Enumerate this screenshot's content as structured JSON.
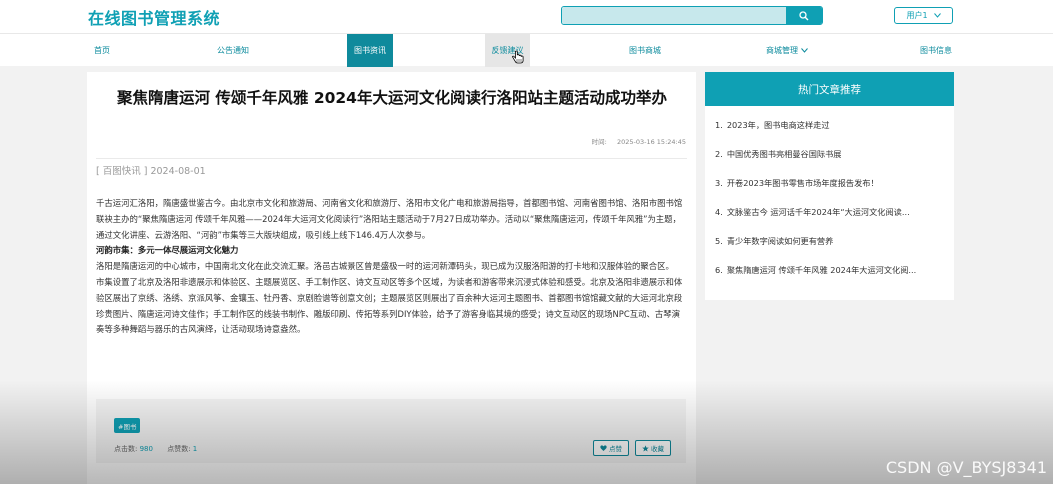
{
  "header": {
    "logo": "在线图书管理系统",
    "search_placeholder": "",
    "user_label": "用户1"
  },
  "nav": [
    {
      "label": "首页"
    },
    {
      "label": "公告通知"
    },
    {
      "label": "图书资讯"
    },
    {
      "label": "反馈建议"
    },
    {
      "label": "图书商城"
    },
    {
      "label": "商城管理"
    },
    {
      "label": "图书信息"
    }
  ],
  "article": {
    "title": "聚焦隋唐运河 传颂千年风雅 2024年大运河文化阅读行洛阳站主题活动成功举办",
    "time_label": "时间:",
    "time_value": "2025-03-16 15:24:45",
    "tag_line": "[ 百图快讯 ] 2024-08-01",
    "para1": "千古运河汇洛阳，隋唐盛世鉴古今。由北京市文化和旅游局、河南省文化和旅游厅、洛阳市文化广电和旅游局指导，首都图书馆、河南省图书馆、洛阳市图书馆联袂主办的“聚焦隋唐运河 传颂千年风雅——2024年大运河文化阅读行”洛阳站主题活动于7月27日成功举办。活动以“聚焦隋唐运河，传颂千年风雅”为主题，通过文化讲座、云游洛阳、“河韵”市集等三大版块组成，吸引线上线下146.4万人次参与。",
    "subtitle": "河韵市集：多元一体尽展运河文化魅力",
    "para2": "洛阳是隋唐运河的中心城市，中国南北文化在此交流汇聚。洛邑古城景区曾是盛极一时的运河新潭码头，现已成为汉服洛阳游的打卡地和汉服体验的聚合区。",
    "para3": "市集设置了北京及洛阳非遗展示和体验区、主题展览区、手工制作区、诗文互动区等多个区域，为读者和游客带来沉浸式体验和感受。北京及洛阳非遗展示和体验区展出了京绣、洛绣、京派风筝、金镶玉、牡丹香、京剧脸谱等创意文创；主题展览区则展出了百余种大运河主题图书、首都图书馆馆藏文献的大运河北京段珍贵图片、隋唐运河诗文佳作；手工制作区的线装书制作、雕版印刷、传拓等系列DIY体验，给予了游客身临其境的感受；诗文互动区的现场NPC互动、古琴演奏等多种舞蹈与器乐的古风演绎，让活动现场诗意盎然。",
    "tag": "#图书",
    "clicks_label": "点击数:",
    "clicks": "980",
    "likes_label": "点赞数:",
    "likes": "1",
    "like_btn": "点赞",
    "fav_btn": "收藏"
  },
  "sidebar": {
    "title": "热门文章推荐",
    "items": [
      {
        "idx": "1.",
        "label": "2023年，图书电商这样走过"
      },
      {
        "idx": "2.",
        "label": "中国优秀图书亮相曼谷国际书展"
      },
      {
        "idx": "3.",
        "label": "开卷2023年图书零售市场年度报告发布！"
      },
      {
        "idx": "4.",
        "label": "文脉鉴古今 运河话千年2024年“大运河文化阅读..."
      },
      {
        "idx": "5.",
        "label": "青少年数字阅读如何更有营养"
      },
      {
        "idx": "6.",
        "label": "聚焦隋唐运河 传颂千年风雅 2024年大运河文化阅..."
      }
    ]
  },
  "watermark": "CSDN @V_BYSJ8341",
  "colors": {
    "accent": "#0fa0b4",
    "nav_active": "#0f8a9c"
  }
}
